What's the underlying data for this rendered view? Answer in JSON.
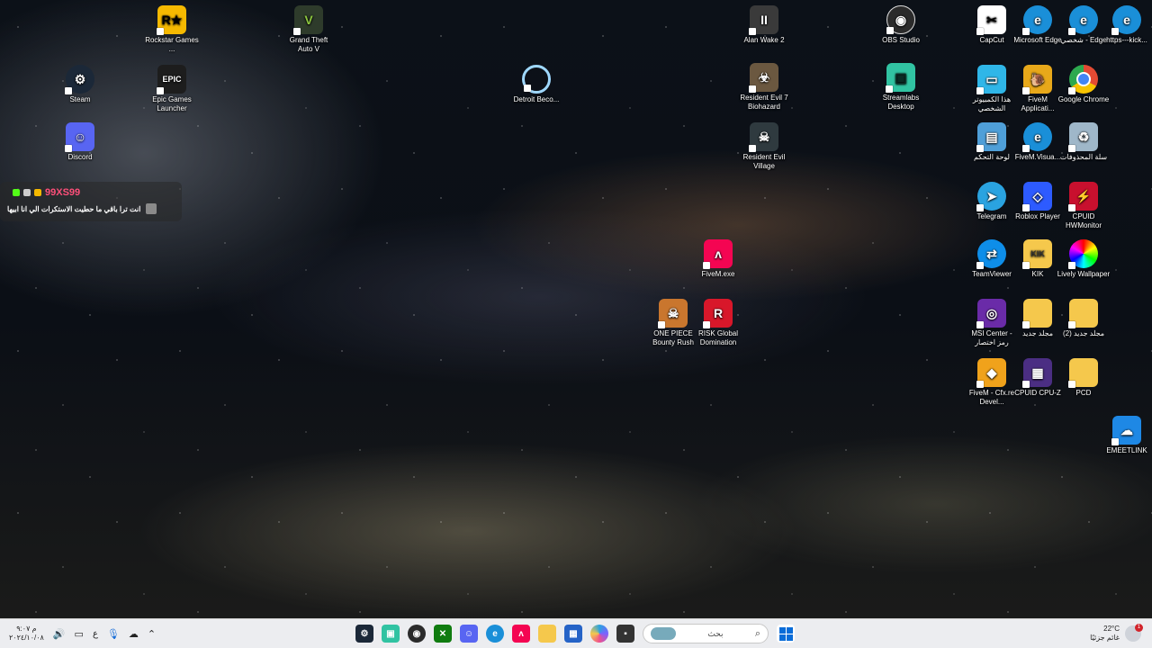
{
  "desktop": {
    "icons": {
      "rockstar": "Rockstar Games ...",
      "gta": "Grand Theft Auto V",
      "alan_wake": "Alan Wake 2",
      "obs": "OBS Studio",
      "capcut": "CapCut",
      "edge1": "Microsoft Edge",
      "edge2": "شخصي - Edge",
      "kick": "https---kick...",
      "steam": "Steam",
      "epic": "Epic Games Launcher",
      "detroit": "Detroit Beco...",
      "re7": "Resident Evil 7 Biohazard",
      "streamlabs": "Streamlabs Desktop",
      "this_pc": "هذا الكمبيوتر الشخصي",
      "fivem_app": "FiveM Applicati...",
      "chrome": "Google Chrome",
      "discord": "Discord",
      "re_village": "Resident Evil Village",
      "control_panel": "لوحة التحكم",
      "fivem_visual": "FiveM.Visua...",
      "recycle_bin": "سلة المحذوفات",
      "telegram": "Telegram",
      "roblox": "Roblox Player",
      "hwmonitor": "CPUID HWMonitor",
      "fivem_exe": "FiveM.exe",
      "teamviewer": "TeamViewer",
      "kik": "KIK",
      "lively": "Lively Wallpaper",
      "one_piece": "ONE PIECE Bounty Rush",
      "risk": "RISK Global Domination",
      "msi": "MSI Center - رمز اختصار",
      "new_folder": "مجلد جديد",
      "new_folder2": "(2) مجلد جديد",
      "fivem_cfx": "FiveM - Cfx.re Devel...",
      "cpuz": "CPUID CPU-Z",
      "pcd": "PCD",
      "emeetlink": "EMEETLINK"
    },
    "overlay": {
      "tag": "99XS99",
      "message": "انت ترا باقي ما حطيت الاستكرات الي انا ابيها"
    }
  },
  "taskbar": {
    "search_placeholder": "بحث",
    "weather_temp": "22°C",
    "weather_desc": "غائم جزئيًا",
    "notification_count": "1",
    "time": "م ٩:٠٧",
    "date": "٢٠٢٤/١٠/٠٨",
    "lang": "ع"
  },
  "colors": {
    "rockstar": "#f6b900",
    "epic": "#1d1d1d",
    "steam": "#1b2838",
    "discord": "#5865f2",
    "obs": "#2b2b2b",
    "streamlabs": "#31c3a2",
    "fivem": "#f40552",
    "telegram": "#2aa3e0",
    "roblox": "#2d5bff",
    "folder": "#f5c84c",
    "msi": "#6a2ba8",
    "edge": "#1a8fd8",
    "chrome": "#e34a33"
  }
}
